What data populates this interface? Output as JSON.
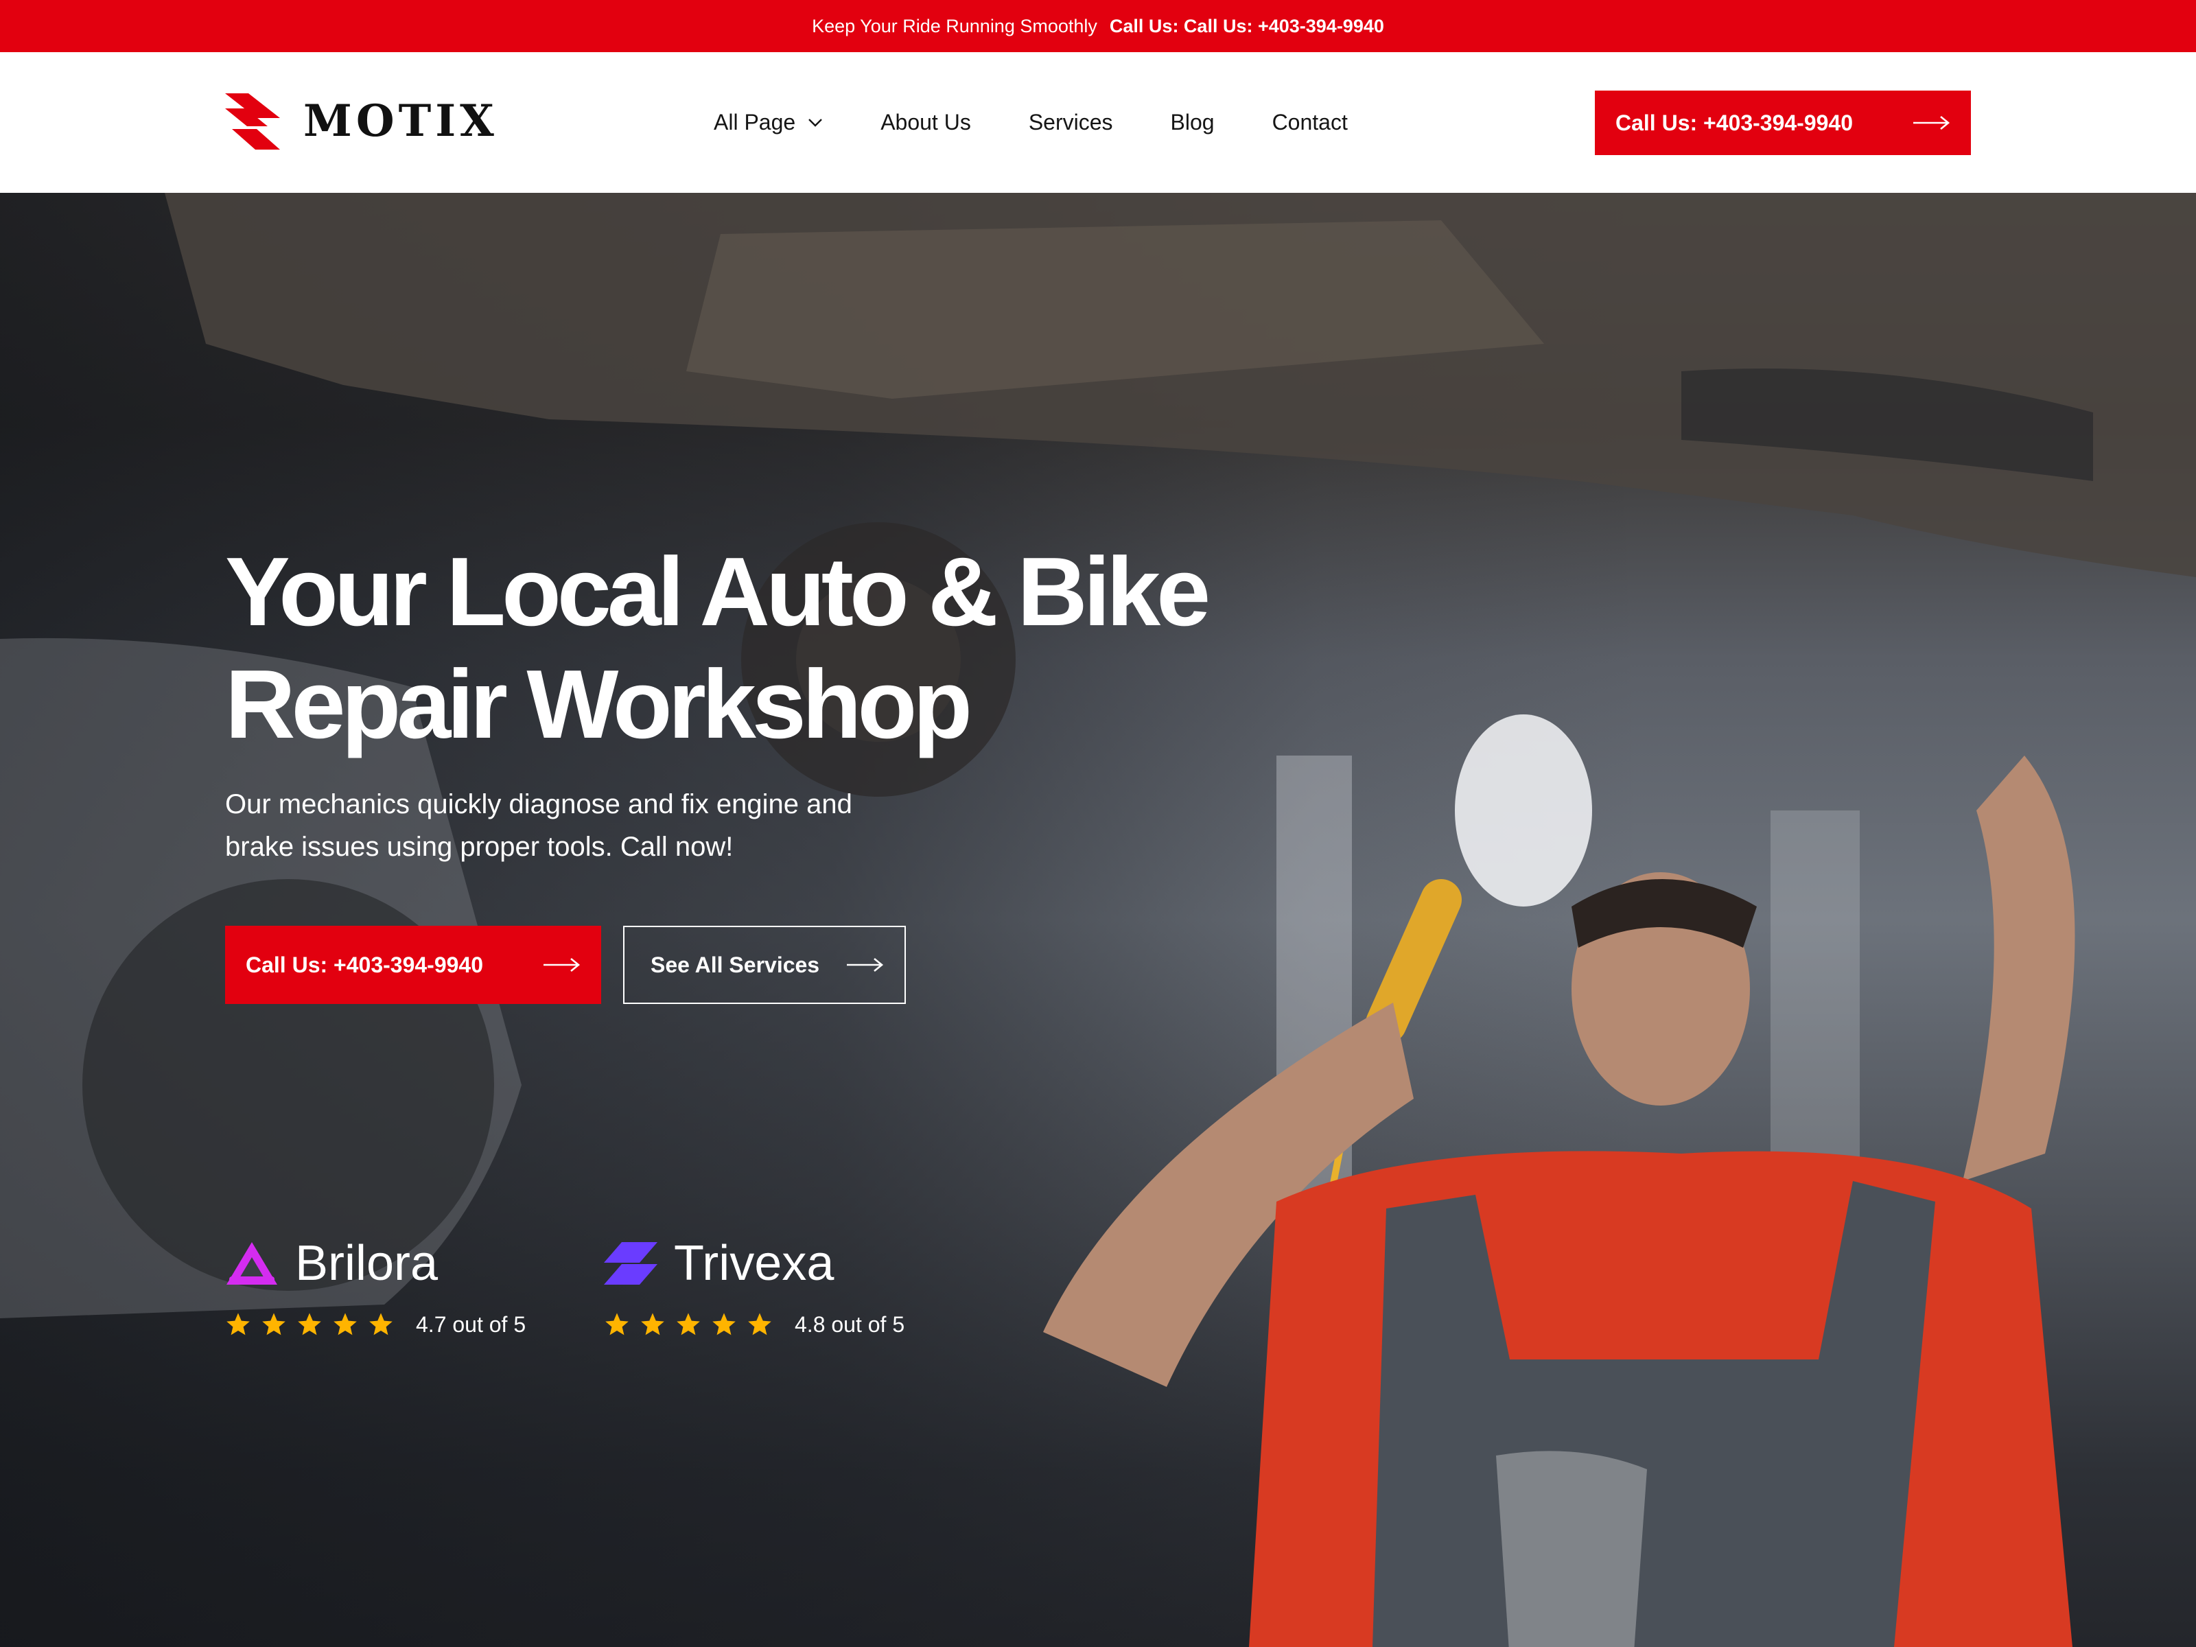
{
  "topbar": {
    "tagline": "Keep Your Ride Running Smoothly",
    "call": "Call Us: Call Us: +403-394-9940"
  },
  "header": {
    "logo_text": "MOTIX",
    "nav": [
      {
        "label": "All Page"
      },
      {
        "label": "About Us"
      },
      {
        "label": "Services"
      },
      {
        "label": "Blog"
      },
      {
        "label": "Contact"
      }
    ],
    "cta": "Call Us: +403-394-9940"
  },
  "hero": {
    "title_line1": "Your Local Auto & Bike",
    "title_line2": "Repair Workshop",
    "subtitle_line1": "Our mechanics quickly diagnose and fix engine and",
    "subtitle_line2": "brake issues using proper tools. Call now!",
    "primary_button": "Call Us: +403-394-9940",
    "secondary_button": "See All Services"
  },
  "ratings": [
    {
      "brand": "Brilora",
      "rating": 4.7,
      "text": "4.7 out of 5",
      "stars": 5
    },
    {
      "brand": "Trivexa",
      "rating": 4.8,
      "text": "4.8 out of 5",
      "stars": 5
    }
  ],
  "colors": {
    "brand_red": "#e2000f",
    "star_yellow": "#ffb400",
    "brilora_magenta": "#d42cf0",
    "trivexa_violet": "#6a3cff"
  },
  "icons": [
    "logo-mark-icon",
    "chevron-down-icon",
    "arrow-right-icon",
    "star-icon",
    "brilora-logo-icon",
    "trivexa-logo-icon"
  ]
}
